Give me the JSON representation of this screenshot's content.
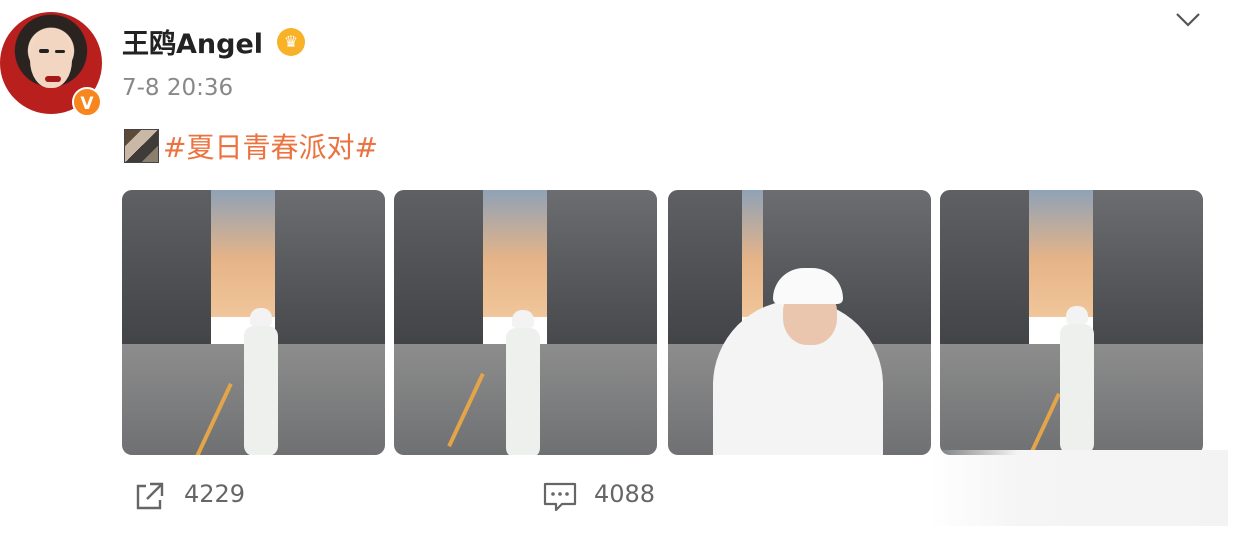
{
  "post": {
    "username": "王鸥Angel",
    "timestamp": "7-8 20:36",
    "hashtag": "#夏日青春派对#",
    "verified_mark": "V",
    "badge_icon": "crown-icon",
    "menu_icon": "chevron-down-icon"
  },
  "photos": [
    {
      "label": "photo-1"
    },
    {
      "label": "photo-2"
    },
    {
      "label": "photo-3"
    },
    {
      "label": "photo-4"
    }
  ],
  "actions": {
    "share_icon": "share-icon",
    "share_count": "4229",
    "comment_icon": "comment-icon",
    "comment_count": "4088"
  },
  "colors": {
    "hashtag": "#eb7340",
    "verified": "#f7861e",
    "badge": "#f8b228",
    "secondary_text": "#888888"
  }
}
